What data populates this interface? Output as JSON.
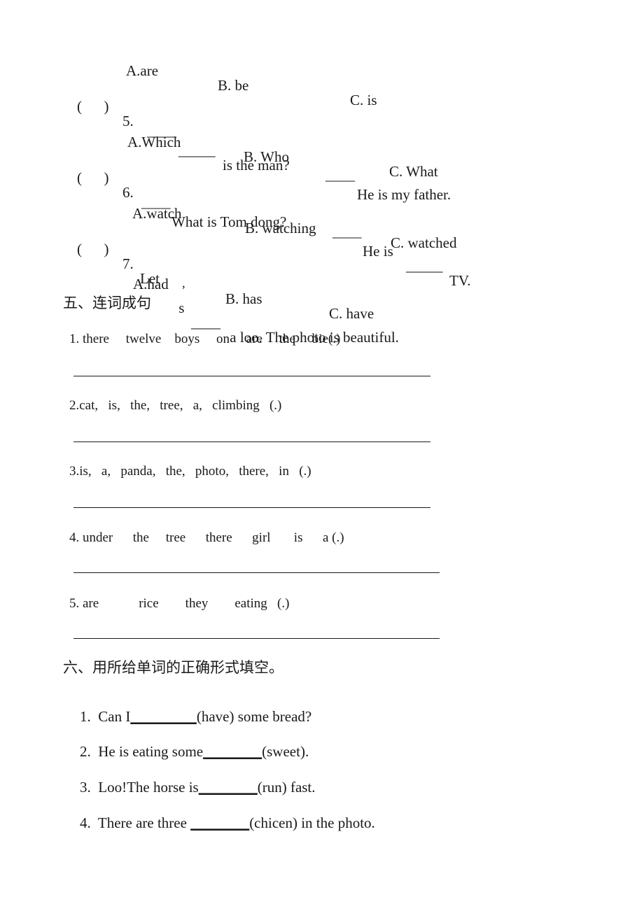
{
  "page": {
    "background": "#ffffff",
    "text_color": "#1a1a1a"
  },
  "top_options": {
    "a": "A.are",
    "b": "B. be",
    "c": "C. is"
  },
  "multiple_choice": [
    {
      "paren": "(      )",
      "number": "5.",
      "stem_dash": "——",
      "stem_blank": "_____",
      "stem_text": "is the man?",
      "answer_dash": "——",
      "answer_text": "He is my father.",
      "options": {
        "a": "A.Which",
        "b": "B. Who",
        "c": "C. What"
      }
    },
    {
      "paren": "(      )",
      "number": "6.",
      "stem_dash": "——",
      "stem_text": "What is Tom dong?",
      "answer_dash": "——",
      "answer_pre": "He is ",
      "answer_blank": "_____",
      "answer_post": "TV.",
      "options": {
        "a": "A.watch",
        "b": "B. watching",
        "c": "C. watched"
      }
    },
    {
      "paren": "(      )",
      "number": "7.",
      "stem_pre": "Let",
      "stem_apos": "’",
      "stem_mid": " s",
      "stem_blank": "____",
      "stem_post": " a loo. The photo is beautiful.",
      "options": {
        "a": "A.had",
        "b": "B. has",
        "c": "C. have"
      }
    }
  ],
  "section_five": {
    "heading": "五、连词成句",
    "items": [
      {
        "text": "1. there     twelve    boys     on     are     the     bie(.)"
      },
      {
        "text": "2.cat,   is,   the,   tree,   a,   climbing   (.)"
      },
      {
        "text": "3.is,   a,   panda,   the,   photo,   there,   in   (.)"
      },
      {
        "text": "4. under      the     tree      there      girl       is      a (.)"
      },
      {
        "text": "5. are            rice        they        eating   (.)"
      }
    ]
  },
  "section_six": {
    "heading": "六、用所给单词的正确形式填空。",
    "items": [
      {
        "number": "1.",
        "pre": "  Can I",
        "blank": "_________",
        "post": "(have) some bread?"
      },
      {
        "number": "2.",
        "pre": "  He is eating some",
        "blank": "________",
        "post": "(sweet)."
      },
      {
        "number": "3.",
        "pre": "  Loo!The horse is",
        "blank": "________",
        "post": "(run) fast."
      },
      {
        "number": "4.",
        "pre": "  There are three ",
        "blank": "________",
        "post": "(chicen) in the photo."
      }
    ]
  }
}
